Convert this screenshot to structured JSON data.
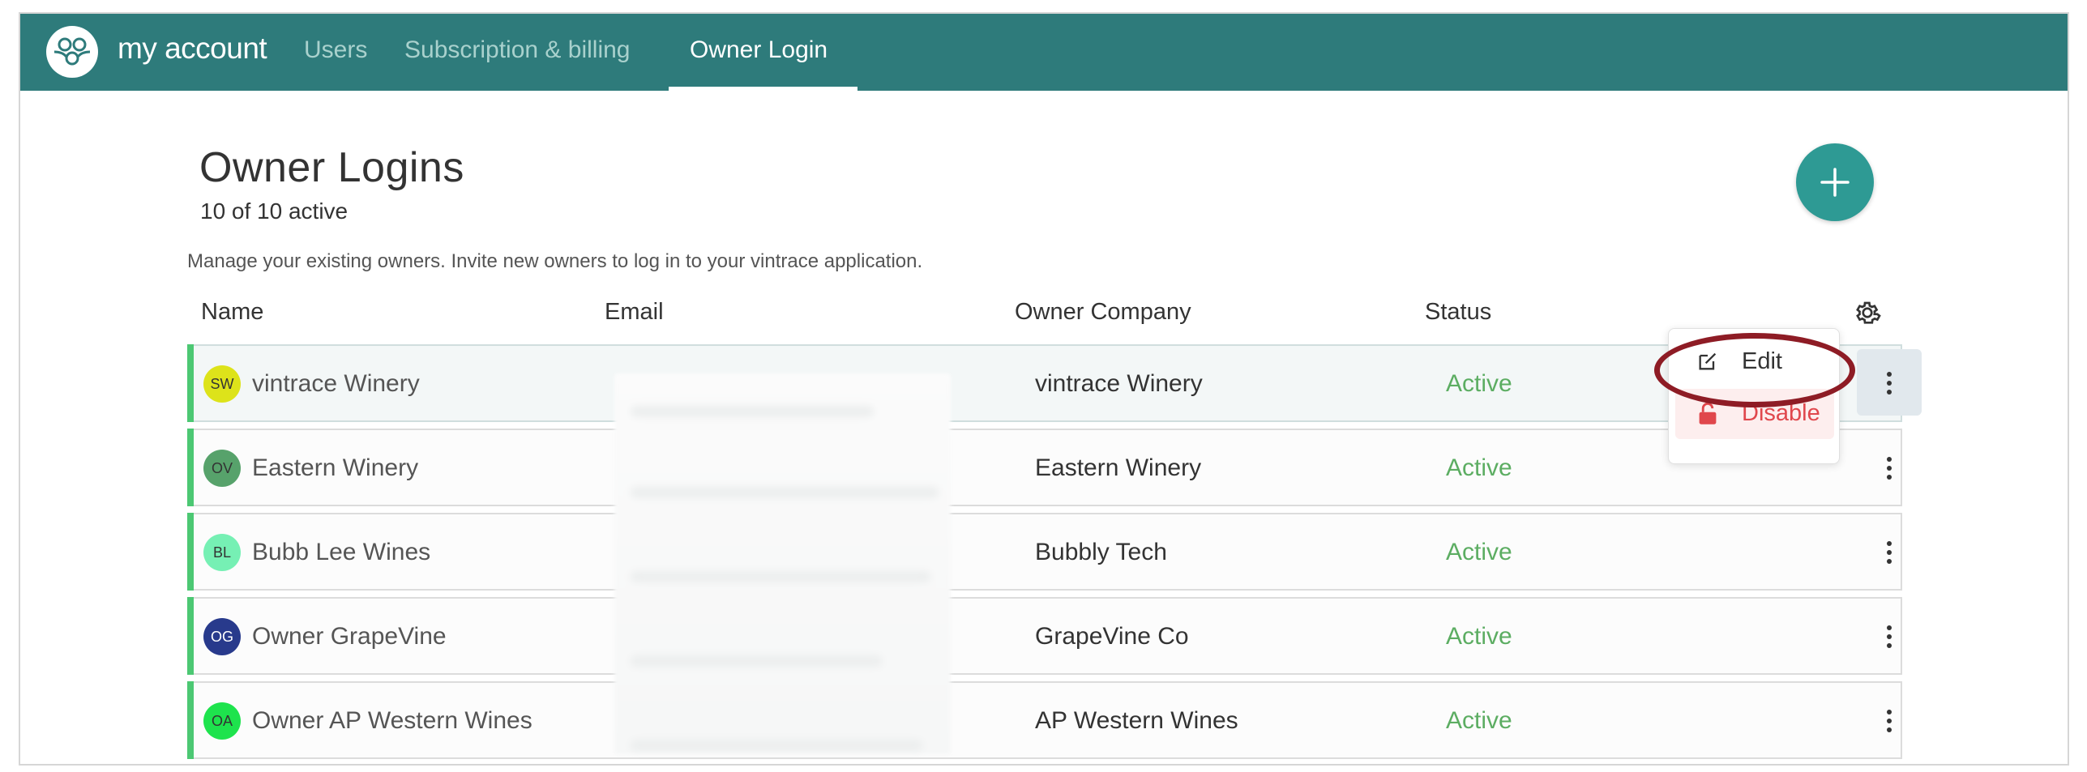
{
  "nav": {
    "brand": "my account",
    "tabs": [
      {
        "label": "Users",
        "active": false
      },
      {
        "label": "Subscription & billing",
        "active": false
      },
      {
        "label": "Owner Login",
        "active": true
      }
    ]
  },
  "page": {
    "title": "Owner Logins",
    "active_count": "10 of 10 active",
    "description": "Manage your existing owners. Invite new owners to log in to your vintrace application."
  },
  "table": {
    "headers": {
      "name": "Name",
      "email": "Email",
      "company": "Owner Company",
      "status": "Status"
    },
    "rows": [
      {
        "initials": "SW",
        "avatar_color": "#dde31a",
        "name": "vintrace Winery",
        "company": "vintrace Winery",
        "status": "Active"
      },
      {
        "initials": "OV",
        "avatar_color": "#57a26b",
        "name": "Eastern Winery",
        "company": "Eastern Winery",
        "status": "Active"
      },
      {
        "initials": "BL",
        "avatar_color": "#76f0b4",
        "name": "Bubb Lee Wines",
        "company": "Bubbly Tech",
        "status": "Active"
      },
      {
        "initials": "OG",
        "avatar_color": "#283a8c",
        "name": "Owner GrapeVine",
        "company": "GrapeVine Co",
        "status": "Active"
      },
      {
        "initials": "OA",
        "avatar_color": "#1ee34d",
        "name": "Owner AP Western Wines",
        "company": "AP Western Wines",
        "status": "Active"
      }
    ]
  },
  "row_menu": {
    "edit_label": "Edit",
    "disable_label": "Disable"
  },
  "colors": {
    "nav_bg": "#2e7b7b",
    "accent": "#2e9a94",
    "status_active": "#5cad62",
    "row_indicator": "#4cc873",
    "danger": "#e0474c",
    "annotation": "#8e1c25"
  }
}
